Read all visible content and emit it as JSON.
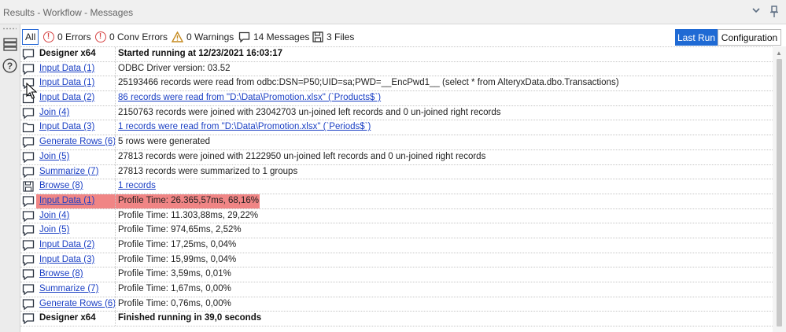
{
  "window": {
    "title": "Results - Workflow - Messages"
  },
  "filters": {
    "all": "All",
    "errors": "0 Errors",
    "conv_errors": "0 Conv Errors",
    "warnings": "0 Warnings",
    "messages": "14 Messages",
    "files": "3 Files"
  },
  "toggle": {
    "last_run": "Last Run",
    "configuration": "Configuration"
  },
  "colors": {
    "accent": "#1f6ad4",
    "link": "#1a3fc4",
    "highlight": "#f08585",
    "error": "#d64545",
    "warning": "#c58a1f"
  },
  "rows": [
    {
      "icon": "message-icon",
      "tool": "Designer x64",
      "msg": "Started running at 12/23/2021 16:03:17",
      "tool_link": false,
      "msg_link": false,
      "bold": true,
      "highlight": false
    },
    {
      "icon": "message-icon",
      "tool": "Input Data (1)",
      "msg": "ODBC Driver version: 03.52",
      "tool_link": true,
      "msg_link": false,
      "bold": false,
      "highlight": false
    },
    {
      "icon": "message-icon",
      "tool": "Input Data (1)",
      "msg": "25193466 records were read from odbc:DSN=P50;UID=sa;PWD=__EncPwd1__ (select *  from AlteryxData.dbo.Transactions)",
      "tool_link": true,
      "msg_link": false,
      "bold": false,
      "highlight": false
    },
    {
      "icon": "folder-icon",
      "tool": "Input Data (2)",
      "msg": "86 records were read from \"D:\\Data\\Promotion.xlsx\" (`Products$`)",
      "tool_link": true,
      "msg_link": true,
      "bold": false,
      "highlight": false
    },
    {
      "icon": "message-icon",
      "tool": "Join (4)",
      "msg": "2150763 records were joined with 23042703 un-joined left records and 0 un-joined right records",
      "tool_link": true,
      "msg_link": false,
      "bold": false,
      "highlight": false
    },
    {
      "icon": "folder-icon",
      "tool": "Input Data (3)",
      "msg": "1 records were read from \"D:\\Data\\Promotion.xlsx\" (`Periods$`)",
      "tool_link": true,
      "msg_link": true,
      "bold": false,
      "highlight": false
    },
    {
      "icon": "message-icon",
      "tool": "Generate Rows (6)",
      "msg": "5 rows were generated",
      "tool_link": true,
      "msg_link": false,
      "bold": false,
      "highlight": false
    },
    {
      "icon": "message-icon",
      "tool": "Join (5)",
      "msg": "27813 records were joined with 2122950 un-joined left records and 0 un-joined right records",
      "tool_link": true,
      "msg_link": false,
      "bold": false,
      "highlight": false
    },
    {
      "icon": "message-icon",
      "tool": "Summarize (7)",
      "msg": "27813 records were summarized to 1 groups",
      "tool_link": true,
      "msg_link": false,
      "bold": false,
      "highlight": false
    },
    {
      "icon": "save-icon",
      "tool": "Browse (8)",
      "msg": "1 records",
      "tool_link": true,
      "msg_link": true,
      "bold": false,
      "highlight": false
    },
    {
      "icon": "message-icon",
      "tool": "Input Data (1)",
      "msg": "Profile Time: 26.365,57ms, 68,16%",
      "tool_link": true,
      "msg_link": false,
      "bold": false,
      "highlight": true
    },
    {
      "icon": "message-icon",
      "tool": "Join (4)",
      "msg": "Profile Time: 11.303,88ms, 29,22%",
      "tool_link": true,
      "msg_link": false,
      "bold": false,
      "highlight": false
    },
    {
      "icon": "message-icon",
      "tool": "Join (5)",
      "msg": "Profile Time: 974,65ms, 2,52%",
      "tool_link": true,
      "msg_link": false,
      "bold": false,
      "highlight": false
    },
    {
      "icon": "message-icon",
      "tool": "Input Data (2)",
      "msg": "Profile Time: 17,25ms, 0,04%",
      "tool_link": true,
      "msg_link": false,
      "bold": false,
      "highlight": false
    },
    {
      "icon": "message-icon",
      "tool": "Input Data (3)",
      "msg": "Profile Time: 15,99ms, 0,04%",
      "tool_link": true,
      "msg_link": false,
      "bold": false,
      "highlight": false
    },
    {
      "icon": "message-icon",
      "tool": "Browse (8)",
      "msg": "Profile Time: 3,59ms, 0,01%",
      "tool_link": true,
      "msg_link": false,
      "bold": false,
      "highlight": false
    },
    {
      "icon": "message-icon",
      "tool": "Summarize (7)",
      "msg": "Profile Time: 1,67ms, 0,00%",
      "tool_link": true,
      "msg_link": false,
      "bold": false,
      "highlight": false
    },
    {
      "icon": "message-icon",
      "tool": "Generate Rows (6)",
      "msg": "Profile Time: 0,76ms, 0,00%",
      "tool_link": true,
      "msg_link": false,
      "bold": false,
      "highlight": false
    },
    {
      "icon": "message-icon",
      "tool": "Designer x64",
      "msg": "Finished running in 39,0 seconds",
      "tool_link": false,
      "msg_link": false,
      "bold": true,
      "highlight": false
    }
  ]
}
